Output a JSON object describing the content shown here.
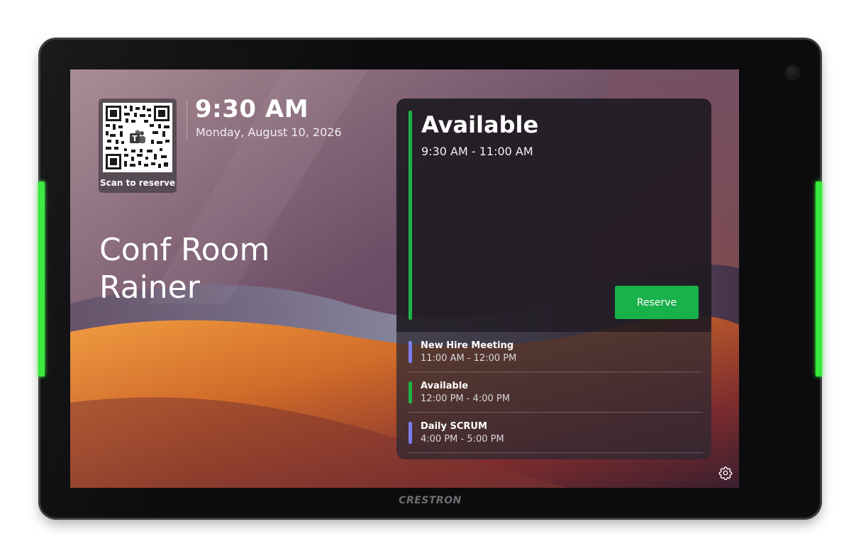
{
  "device": {
    "brand": "CRESTRON",
    "led_color": "#38e83a"
  },
  "header": {
    "time": "9:30 AM",
    "date": "Monday, August 10, 2026"
  },
  "qr": {
    "label": "Scan to reserve",
    "icon": "teams-icon"
  },
  "room": {
    "name_line1": "Conf Room",
    "name_line2": "Rainer"
  },
  "current": {
    "status": "Available",
    "time_range": "9:30 AM - 11:00 AM",
    "status_color": "#1fb346",
    "reserve_label": "Reserve"
  },
  "schedule": [
    {
      "title": "New Hire Meeting",
      "time": "11:00 AM - 12:00 PM",
      "color": "#7b7cf0"
    },
    {
      "title": "Available",
      "time": "12:00 PM - 4:00 PM",
      "color": "#1fb346"
    },
    {
      "title": "Daily SCRUM",
      "time": "4:00 PM - 5:00 PM",
      "color": "#7b7cf0"
    }
  ],
  "settings": {
    "icon": "gear-icon"
  }
}
